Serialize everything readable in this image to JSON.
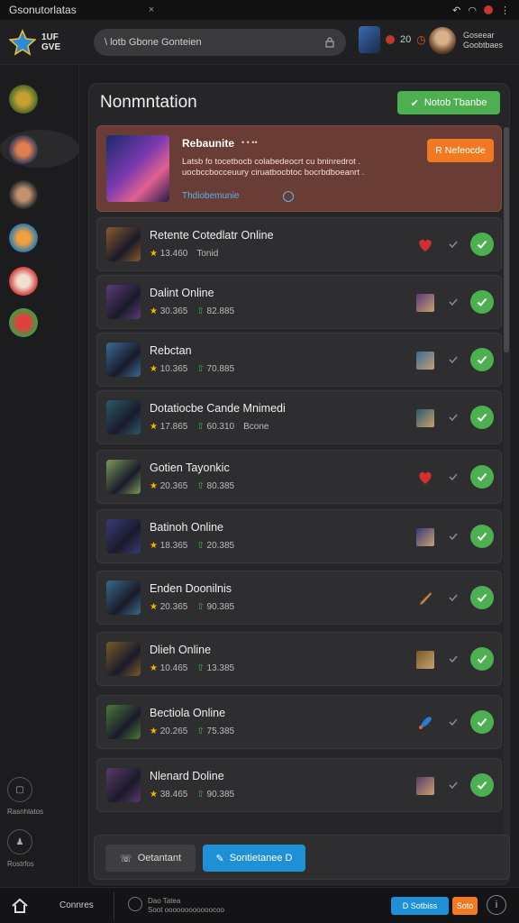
{
  "window": {
    "tab_title": "Gsonutorlatas",
    "tab_close": "×"
  },
  "topbar": {
    "logo_text_1": "1UF",
    "logo_text_2": "GVE",
    "search_placeholder": "\\ lotb Gbone Gonteien",
    "count": "20",
    "user_name_1": "Goseear",
    "user_name_2": "Goobtbaes"
  },
  "panel": {
    "title": "Nonmntation",
    "mark_button": "Notob Tbanbe"
  },
  "featured": {
    "title": "Rebaunite",
    "dots": "•   •  ••",
    "description": "Latsb fo tocetbocb colabedeocrt cu bninredrot . uocbccbocceuury ciruatbocbtoc bocrbdboeanrt .",
    "link": "Thdiobemunie",
    "button": "R Nefeocde"
  },
  "rows": [
    {
      "name": "Retente Cotedlatr Online",
      "s1": "13.460",
      "s2": "Tonid",
      "s2_up": false,
      "icon1": "heart-icon",
      "accent": "#8b5a2b"
    },
    {
      "name": "Dalint Online",
      "s1": "30.365",
      "s2": "82.885",
      "s2_up": true,
      "icon1": "character-thumb-icon",
      "accent": "#5a3a7a"
    },
    {
      "name": "Rebctan",
      "s1": "10.365",
      "s2": "70.885",
      "s2_up": true,
      "icon1": "character-thumb-icon",
      "accent": "#3a6a9a"
    },
    {
      "name": "Dotatiocbe Cande Mnimedi",
      "s1": "17.865",
      "s2": "60.310",
      "s2_up": true,
      "s2_extra": "Bcone",
      "icon1": "character-thumb-icon",
      "accent": "#2a5a6a"
    },
    {
      "name": "Gotien Tayonkic",
      "s1": "20.365",
      "s2": "80.385",
      "s2_up": true,
      "icon1": "heart-icon",
      "accent": "#7a9a5a"
    },
    {
      "name": "Batinoh Online",
      "s1": "18.365",
      "s2": "20.385",
      "s2_up": true,
      "icon1": "character-thumb-icon",
      "accent": "#3a3a7a"
    },
    {
      "name": "Enden Doonilnis",
      "s1": "20.365",
      "s2": "90.385",
      "s2_up": true,
      "icon1": "sword-icon",
      "accent": "#3a6a8a"
    },
    {
      "name": "Dlieh Online",
      "s1": "10.465",
      "s2": "13.385",
      "s2_up": true,
      "icon1": "character-thumb-icon",
      "accent": "#7a5a2a"
    },
    {
      "name": "Bectiola Online",
      "s1": "20.265",
      "s2": "75.385",
      "s2_up": true,
      "icon1": "rocket-icon",
      "accent": "#4a7a3a"
    },
    {
      "name": "Nlenard Doline",
      "s1": "38.465",
      "s2": "90.385",
      "s2_up": true,
      "icon1": "character-thumb-icon",
      "accent": "#5a3a6a"
    }
  ],
  "actionbar": {
    "btn1": "Oetantant",
    "btn2": "Sontietanee D"
  },
  "sidebar": {
    "bottom1": "Rasnhlatos",
    "bottom2": "Rostrfos"
  },
  "footer": {
    "label": "Connres",
    "info_1": "Dao Tatea",
    "info_2": "Soot oooooooooooocoo",
    "btn1": "D Sotbiss",
    "btn2": "Soto",
    "help": "i"
  },
  "colors": {
    "accent_green": "#4caf50",
    "accent_orange": "#ef7a22",
    "accent_blue": "#1e90d6",
    "featured_bg": "#6a3c36"
  }
}
